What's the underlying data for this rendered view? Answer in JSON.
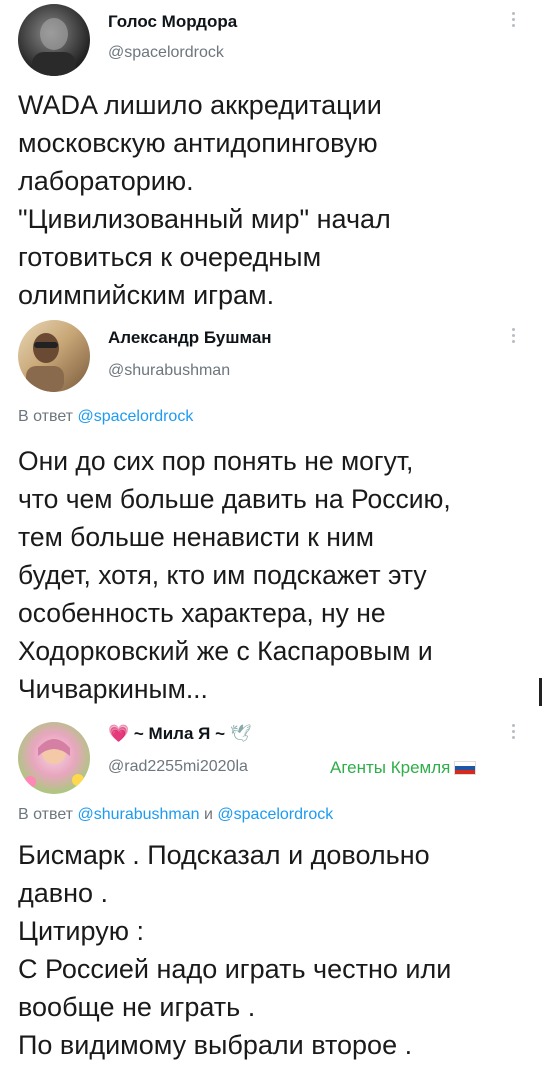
{
  "tweets": [
    {
      "name": "Голос Мордора",
      "handle": "@spacelordrock",
      "text": "WADA лишило аккредитации\nмосковскую антидопинговую\nлабораторию.\n\"Цивилизованный мир\" начал\nготовиться к очередным\nолимпийским играм."
    },
    {
      "name": "Александр Бушман",
      "handle": "@shurabushman",
      "reply_prefix": "В ответ",
      "reply_to": "@spacelordrock",
      "text": "Они до сих пор понять не могут,\nчто чем больше давить на Россию,\nтем больше ненависти к ним\nбудет, хотя, кто им подскажет эту\nособенность характера, ну не\nХодорковский же с Каспаровым и\nЧичваркиным..."
    },
    {
      "name_prefix": "💗",
      "name": "~ Мила Я ~",
      "name_suffix": "🕊",
      "handle": "@rad2255mi2020la",
      "tag": "Агенты Кремля",
      "reply_prefix": "В ответ",
      "reply_to_1": "@shurabushman",
      "reply_and": "и",
      "reply_to_2": "@spacelordrock",
      "text": "Бисмарк . Подсказал и довольно\nдавно .\nЦитирую :\nС Россией надо играть честно или\nвообще не играть .\nПо видимому выбрали второе ."
    }
  ],
  "colors": {
    "link": "#1d9bf0",
    "tag": "#2fae4a",
    "muted": "#6e767d",
    "flag": [
      "#ffffff",
      "#1c57a7",
      "#d52b1e"
    ]
  },
  "icons": [
    "avatar-photo",
    "more-options-icon",
    "russian-flag-icon",
    "heart-icon",
    "dove-icon"
  ]
}
